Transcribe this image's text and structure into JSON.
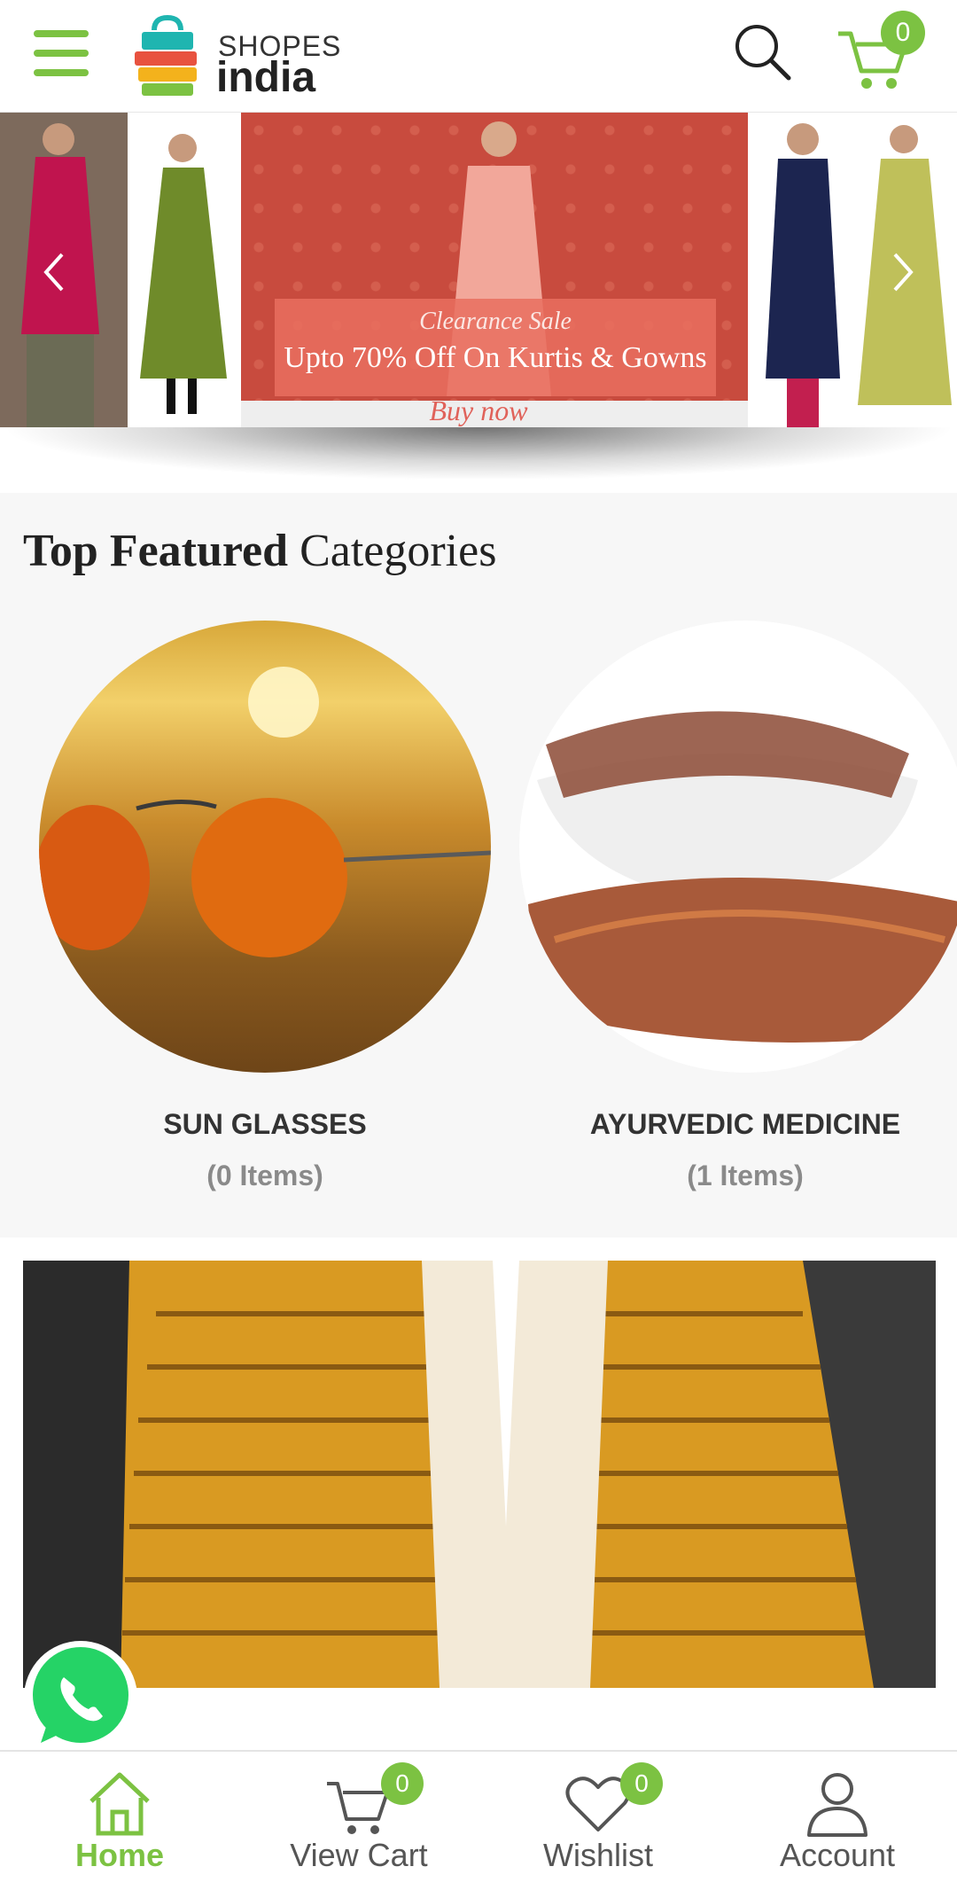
{
  "header": {
    "logo_top": "SHOPES",
    "logo_bottom": "india",
    "cart_count": "0"
  },
  "banner": {
    "sale_label": "Clearance Sale",
    "offer_text": "Upto 70% Off On Kurtis & Gowns",
    "cta": "Buy now"
  },
  "categories": {
    "title_bold": "Top Featured",
    "title_rest": "Categories",
    "items": [
      {
        "name": "SUN GLASSES",
        "count": "(0 Items)"
      },
      {
        "name": "AYURVEDIC MEDICINE",
        "count": "(1 Items)"
      }
    ]
  },
  "bottom_nav": {
    "items": [
      {
        "label": "Home",
        "icon": "home-icon",
        "active": true
      },
      {
        "label": "View Cart",
        "icon": "cart-icon",
        "badge": "0"
      },
      {
        "label": "Wishlist",
        "icon": "heart-icon",
        "badge": "0"
      },
      {
        "label": "Account",
        "icon": "user-icon"
      }
    ]
  },
  "colors": {
    "accent": "#7cc242",
    "text_dark": "#333333",
    "text_muted": "#8a8a8a"
  }
}
